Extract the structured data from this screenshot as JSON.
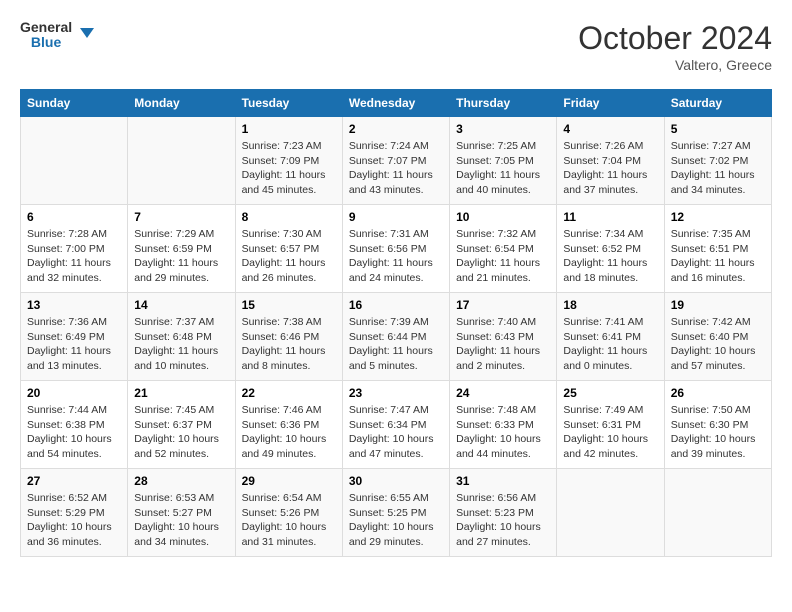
{
  "header": {
    "logo_general": "General",
    "logo_blue": "Blue",
    "month": "October 2024",
    "location": "Valtero, Greece"
  },
  "days_of_week": [
    "Sunday",
    "Monday",
    "Tuesday",
    "Wednesday",
    "Thursday",
    "Friday",
    "Saturday"
  ],
  "weeks": [
    [
      {
        "day": "",
        "sunrise": "",
        "sunset": "",
        "daylight": ""
      },
      {
        "day": "",
        "sunrise": "",
        "sunset": "",
        "daylight": ""
      },
      {
        "day": "1",
        "sunrise": "Sunrise: 7:23 AM",
        "sunset": "Sunset: 7:09 PM",
        "daylight": "Daylight: 11 hours and 45 minutes."
      },
      {
        "day": "2",
        "sunrise": "Sunrise: 7:24 AM",
        "sunset": "Sunset: 7:07 PM",
        "daylight": "Daylight: 11 hours and 43 minutes."
      },
      {
        "day": "3",
        "sunrise": "Sunrise: 7:25 AM",
        "sunset": "Sunset: 7:05 PM",
        "daylight": "Daylight: 11 hours and 40 minutes."
      },
      {
        "day": "4",
        "sunrise": "Sunrise: 7:26 AM",
        "sunset": "Sunset: 7:04 PM",
        "daylight": "Daylight: 11 hours and 37 minutes."
      },
      {
        "day": "5",
        "sunrise": "Sunrise: 7:27 AM",
        "sunset": "Sunset: 7:02 PM",
        "daylight": "Daylight: 11 hours and 34 minutes."
      }
    ],
    [
      {
        "day": "6",
        "sunrise": "Sunrise: 7:28 AM",
        "sunset": "Sunset: 7:00 PM",
        "daylight": "Daylight: 11 hours and 32 minutes."
      },
      {
        "day": "7",
        "sunrise": "Sunrise: 7:29 AM",
        "sunset": "Sunset: 6:59 PM",
        "daylight": "Daylight: 11 hours and 29 minutes."
      },
      {
        "day": "8",
        "sunrise": "Sunrise: 7:30 AM",
        "sunset": "Sunset: 6:57 PM",
        "daylight": "Daylight: 11 hours and 26 minutes."
      },
      {
        "day": "9",
        "sunrise": "Sunrise: 7:31 AM",
        "sunset": "Sunset: 6:56 PM",
        "daylight": "Daylight: 11 hours and 24 minutes."
      },
      {
        "day": "10",
        "sunrise": "Sunrise: 7:32 AM",
        "sunset": "Sunset: 6:54 PM",
        "daylight": "Daylight: 11 hours and 21 minutes."
      },
      {
        "day": "11",
        "sunrise": "Sunrise: 7:34 AM",
        "sunset": "Sunset: 6:52 PM",
        "daylight": "Daylight: 11 hours and 18 minutes."
      },
      {
        "day": "12",
        "sunrise": "Sunrise: 7:35 AM",
        "sunset": "Sunset: 6:51 PM",
        "daylight": "Daylight: 11 hours and 16 minutes."
      }
    ],
    [
      {
        "day": "13",
        "sunrise": "Sunrise: 7:36 AM",
        "sunset": "Sunset: 6:49 PM",
        "daylight": "Daylight: 11 hours and 13 minutes."
      },
      {
        "day": "14",
        "sunrise": "Sunrise: 7:37 AM",
        "sunset": "Sunset: 6:48 PM",
        "daylight": "Daylight: 11 hours and 10 minutes."
      },
      {
        "day": "15",
        "sunrise": "Sunrise: 7:38 AM",
        "sunset": "Sunset: 6:46 PM",
        "daylight": "Daylight: 11 hours and 8 minutes."
      },
      {
        "day": "16",
        "sunrise": "Sunrise: 7:39 AM",
        "sunset": "Sunset: 6:44 PM",
        "daylight": "Daylight: 11 hours and 5 minutes."
      },
      {
        "day": "17",
        "sunrise": "Sunrise: 7:40 AM",
        "sunset": "Sunset: 6:43 PM",
        "daylight": "Daylight: 11 hours and 2 minutes."
      },
      {
        "day": "18",
        "sunrise": "Sunrise: 7:41 AM",
        "sunset": "Sunset: 6:41 PM",
        "daylight": "Daylight: 11 hours and 0 minutes."
      },
      {
        "day": "19",
        "sunrise": "Sunrise: 7:42 AM",
        "sunset": "Sunset: 6:40 PM",
        "daylight": "Daylight: 10 hours and 57 minutes."
      }
    ],
    [
      {
        "day": "20",
        "sunrise": "Sunrise: 7:44 AM",
        "sunset": "Sunset: 6:38 PM",
        "daylight": "Daylight: 10 hours and 54 minutes."
      },
      {
        "day": "21",
        "sunrise": "Sunrise: 7:45 AM",
        "sunset": "Sunset: 6:37 PM",
        "daylight": "Daylight: 10 hours and 52 minutes."
      },
      {
        "day": "22",
        "sunrise": "Sunrise: 7:46 AM",
        "sunset": "Sunset: 6:36 PM",
        "daylight": "Daylight: 10 hours and 49 minutes."
      },
      {
        "day": "23",
        "sunrise": "Sunrise: 7:47 AM",
        "sunset": "Sunset: 6:34 PM",
        "daylight": "Daylight: 10 hours and 47 minutes."
      },
      {
        "day": "24",
        "sunrise": "Sunrise: 7:48 AM",
        "sunset": "Sunset: 6:33 PM",
        "daylight": "Daylight: 10 hours and 44 minutes."
      },
      {
        "day": "25",
        "sunrise": "Sunrise: 7:49 AM",
        "sunset": "Sunset: 6:31 PM",
        "daylight": "Daylight: 10 hours and 42 minutes."
      },
      {
        "day": "26",
        "sunrise": "Sunrise: 7:50 AM",
        "sunset": "Sunset: 6:30 PM",
        "daylight": "Daylight: 10 hours and 39 minutes."
      }
    ],
    [
      {
        "day": "27",
        "sunrise": "Sunrise: 6:52 AM",
        "sunset": "Sunset: 5:29 PM",
        "daylight": "Daylight: 10 hours and 36 minutes."
      },
      {
        "day": "28",
        "sunrise": "Sunrise: 6:53 AM",
        "sunset": "Sunset: 5:27 PM",
        "daylight": "Daylight: 10 hours and 34 minutes."
      },
      {
        "day": "29",
        "sunrise": "Sunrise: 6:54 AM",
        "sunset": "Sunset: 5:26 PM",
        "daylight": "Daylight: 10 hours and 31 minutes."
      },
      {
        "day": "30",
        "sunrise": "Sunrise: 6:55 AM",
        "sunset": "Sunset: 5:25 PM",
        "daylight": "Daylight: 10 hours and 29 minutes."
      },
      {
        "day": "31",
        "sunrise": "Sunrise: 6:56 AM",
        "sunset": "Sunset: 5:23 PM",
        "daylight": "Daylight: 10 hours and 27 minutes."
      },
      {
        "day": "",
        "sunrise": "",
        "sunset": "",
        "daylight": ""
      },
      {
        "day": "",
        "sunrise": "",
        "sunset": "",
        "daylight": ""
      }
    ]
  ]
}
